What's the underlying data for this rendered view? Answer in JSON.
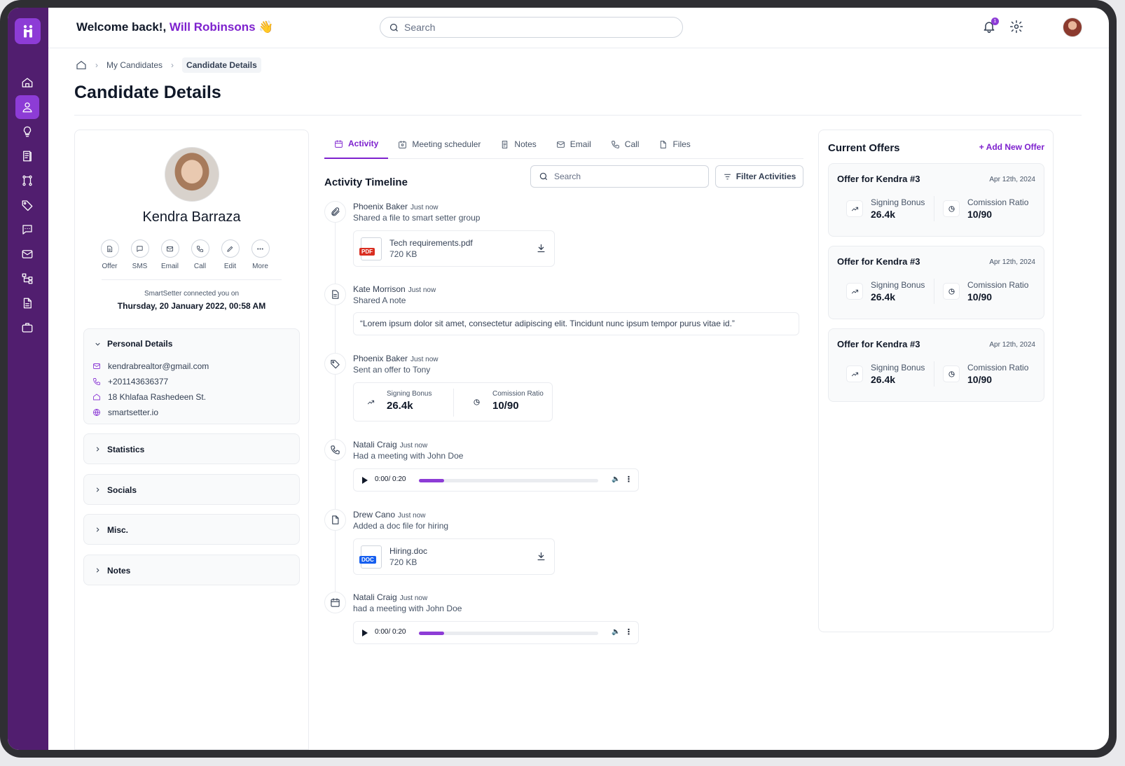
{
  "header": {
    "welcome_prefix": "Welcome back!,",
    "user_name": "Will Robinsons",
    "wave": "👋",
    "search_placeholder": "Search",
    "notification_count": "1"
  },
  "breadcrumb": {
    "level1": "My Candidates",
    "level2": "Candidate Details"
  },
  "page_title": "Candidate Details",
  "candidate": {
    "name": "Kendra Barraza",
    "actions": [
      "Offer",
      "SMS",
      "Email",
      "Call",
      "Edit",
      "More"
    ],
    "connected_label": "SmartSetter connected you on",
    "connected_date": "Thursday, 20 January 2022, 00:58 AM",
    "personal_details_title": "Personal Details",
    "email": "kendrabrealtor@gmail.com",
    "phone": "+201143636377",
    "address": "18 Khlafaa Rashedeen St.",
    "website": "smartsetter.io",
    "sections": [
      "Statistics",
      "Socials",
      "Misc.",
      "Notes"
    ]
  },
  "tabs": [
    "Activity",
    "Meeting scheduler",
    "Notes",
    "Email",
    "Call",
    "Files"
  ],
  "activity": {
    "title": "Activity Timeline",
    "search_placeholder": "Search",
    "filter_label": "Filter Activities",
    "events": [
      {
        "name": "Phoenix Baker",
        "time": "Just now",
        "desc": "Shared a file to smart setter group",
        "file_name": "Tech requirements.pdf",
        "file_size": "720 KB",
        "file_tag": "PDF"
      },
      {
        "name": "Kate Morrison",
        "time": "Just now",
        "desc": "Shared A note",
        "note": "“Lorem ipsum dolor sit amet, consectetur adipiscing elit. Tincidunt nunc ipsum tempor purus vitae id.”"
      },
      {
        "name": "Phoenix Baker",
        "time": "Just now",
        "desc": "Sent an offer to Tony",
        "bonus_label": "Signing Bonus",
        "bonus_value": "26.4k",
        "ratio_label": "Comission Ratio",
        "ratio_value": "10/90"
      },
      {
        "name": "Natali Craig",
        "time": "Just now",
        "desc": "Had a meeting with John Doe",
        "audio_time": "0:00/ 0:20",
        "progress": 0.14
      },
      {
        "name": "Drew Cano",
        "time": "Just now",
        "desc": "Added a doc file for hiring",
        "file_name": "Hiring.doc",
        "file_size": "720 KB",
        "file_tag": "DOC"
      },
      {
        "name": "Natali Craig",
        "time": "Just now",
        "desc": "had a meeting with John Doe",
        "audio_time": "0:00/ 0:20",
        "progress": 0.14
      }
    ]
  },
  "offers": {
    "title": "Current Offers",
    "add_label": "Add New Offer",
    "items": [
      {
        "title": "Offer for Kendra #3",
        "date": "Apr 12th, 2024",
        "bonus_label": "Signing Bonus",
        "bonus_value": "26.4k",
        "ratio_label": "Comission Ratio",
        "ratio_value": "10/90"
      },
      {
        "title": "Offer for Kendra #3",
        "date": "Apr 12th, 2024",
        "bonus_label": "Signing Bonus",
        "bonus_value": "26.4k",
        "ratio_label": "Comission Ratio",
        "ratio_value": "10/90"
      },
      {
        "title": "Offer for Kendra #3",
        "date": "Apr 12th, 2024",
        "bonus_label": "Signing Bonus",
        "bonus_value": "26.4k",
        "ratio_label": "Comission Ratio",
        "ratio_value": "10/90"
      }
    ]
  },
  "colors": {
    "sidebar": "#511e6f",
    "accent": "#8d3cd6",
    "accent_text": "#7e22ce",
    "pdf_tag": "#d92d20",
    "doc_tag": "#155eef"
  }
}
